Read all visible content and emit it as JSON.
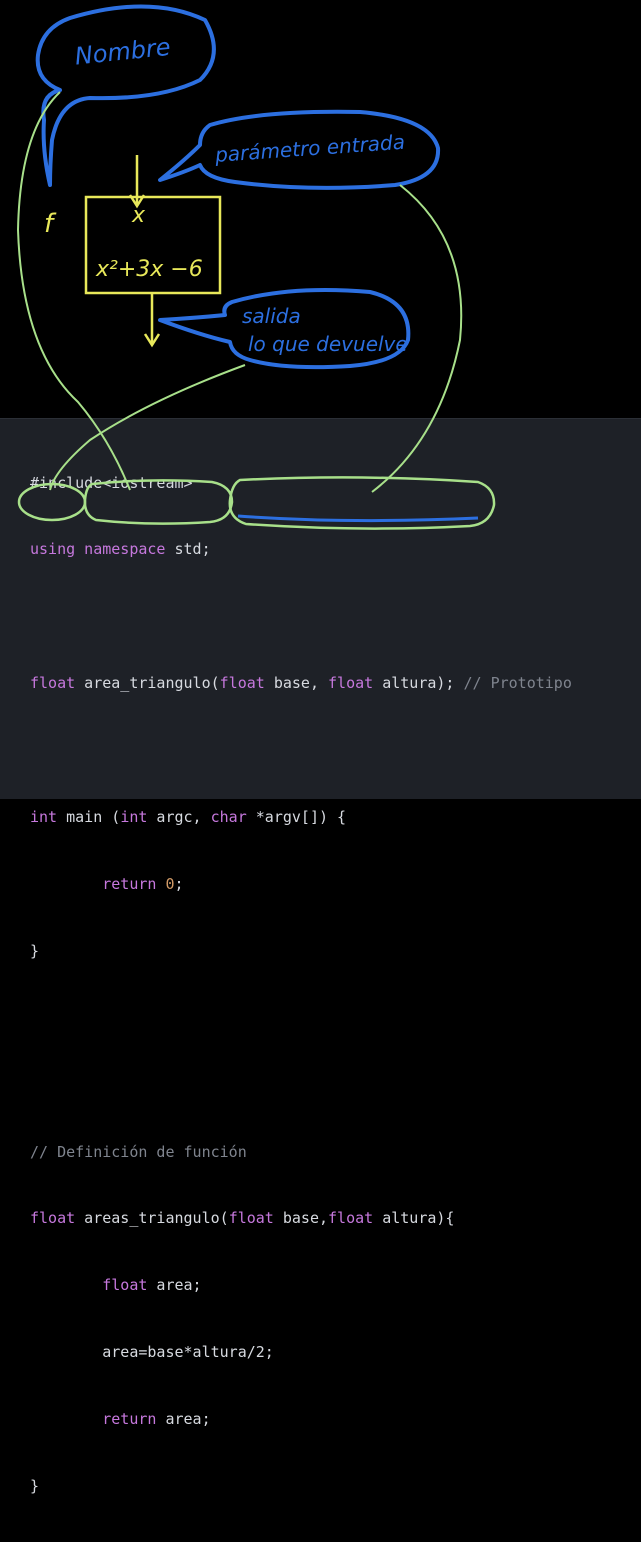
{
  "annotations": {
    "nombre": "Nombre",
    "parametro": "parámetro entrada",
    "salida_1": "salida",
    "salida_2": "lo que devuelve",
    "f_label": "f",
    "x_label": "x",
    "expression": "x²+3x −6"
  },
  "code": {
    "line1": {
      "t": "#include<iostream>"
    },
    "line2": {
      "k": "using namespace",
      "t": " std;"
    },
    "line4": {
      "k1": "float",
      "n": " area_triangulo(",
      "k2": "float",
      "p1": " base, ",
      "k3": "float",
      "p2": " altura);",
      "c": " // Prototipo"
    },
    "line6": {
      "k1": "int",
      "n": " main (",
      "k2": "int",
      "p1": " argc, ",
      "k3": "char",
      "p2": " *argv[]) {"
    },
    "line7": {
      "indent": "        ",
      "k": "return",
      "sp": " ",
      "num": "0",
      "end": ";"
    },
    "line8": {
      "t": "}"
    },
    "line11": {
      "c": "// Definición de función"
    },
    "line12": {
      "k1": "float",
      "n": " areas_triangulo(",
      "k2": "float",
      "p1": " base,",
      "k3": "float",
      "p2": " altura){"
    },
    "line13": {
      "indent": "        ",
      "k": "float",
      "t": " area;"
    },
    "line14": {
      "indent": "        ",
      "t": "area=base*altura/2;"
    },
    "line15": {
      "indent": "        ",
      "k": "return",
      "t": " area;"
    },
    "line16": {
      "t": "}"
    }
  },
  "colors": {
    "blue_ink": "#2c6fe0",
    "green_ink": "#a8e08a",
    "yellow_ink": "#e8e85a",
    "keyword": "#c678dd",
    "number": "#d19a66",
    "comment": "#7f848e"
  }
}
